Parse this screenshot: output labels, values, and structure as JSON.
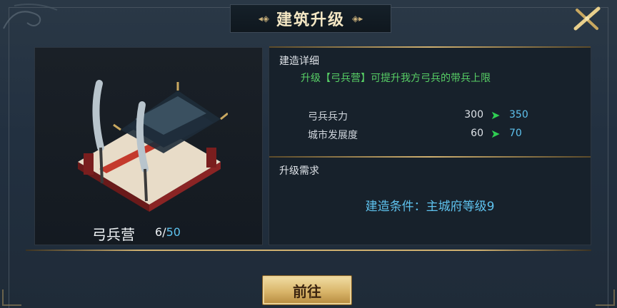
{
  "title": {
    "text": "建筑升级"
  },
  "building": {
    "name": "弓兵营",
    "level": "6",
    "max_level": "50"
  },
  "details": {
    "section_label": "建造详细",
    "description": "升级【弓兵营】可提升我方弓兵的带兵上限",
    "stats": [
      {
        "name": "弓兵兵力",
        "old": "300",
        "new": "350"
      },
      {
        "name": "城市发展度",
        "old": "60",
        "new": "70"
      }
    ]
  },
  "requirements": {
    "section_label": "升级需求",
    "text": "建造条件：主城府等级9"
  },
  "button": {
    "label": "前往"
  },
  "icons": {
    "close": "close-crossed-blades-icon",
    "arrow": "right-arrow-icon"
  },
  "colors": {
    "accent_gold": "#cfb070",
    "value_blue": "#5ec2ee",
    "positive_green": "#58d066"
  }
}
